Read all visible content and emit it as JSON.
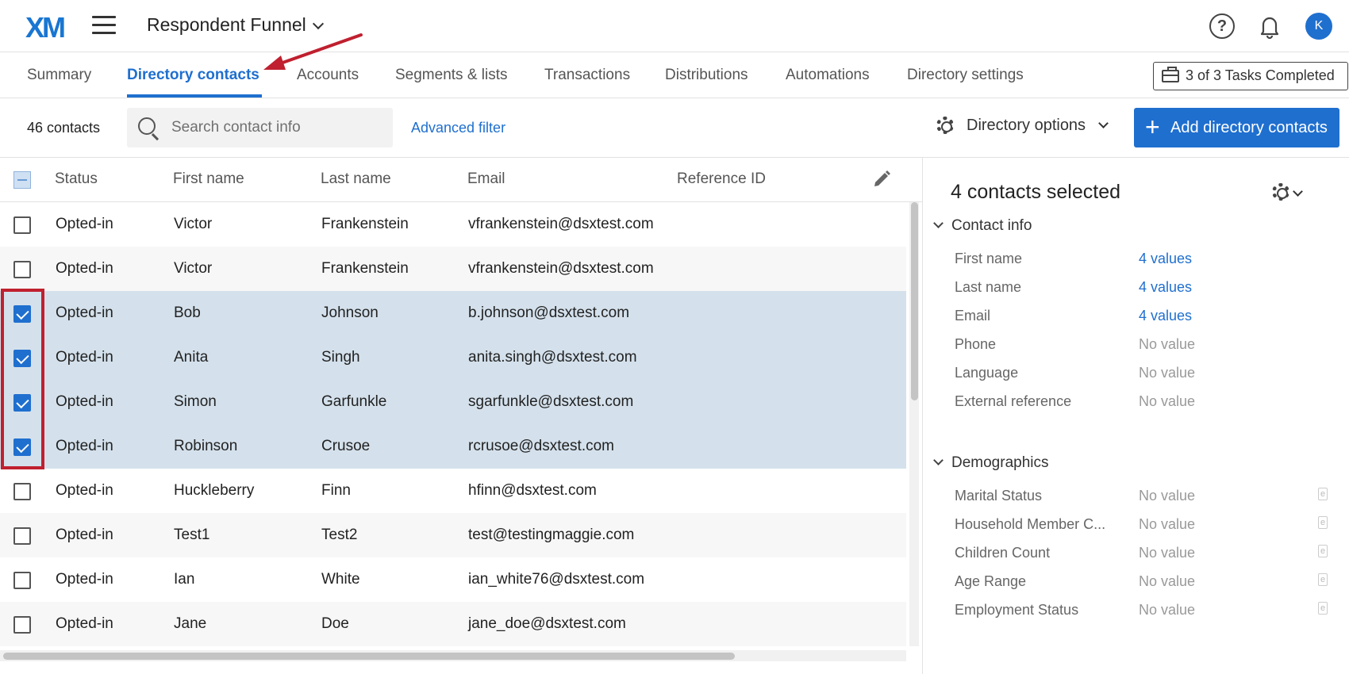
{
  "header": {
    "logo": "XM",
    "project": "Respondent Funnel",
    "help_glyph": "?",
    "avatar_initial": "K"
  },
  "tabs": [
    {
      "label": "Summary"
    },
    {
      "label": "Directory contacts"
    },
    {
      "label": "Accounts"
    },
    {
      "label": "Segments & lists"
    },
    {
      "label": "Transactions"
    },
    {
      "label": "Distributions"
    },
    {
      "label": "Automations"
    },
    {
      "label": "Directory settings"
    }
  ],
  "active_tab": "Directory contacts",
  "tasks_label": "3 of 3 Tasks Completed",
  "toolbar": {
    "count": "46 contacts",
    "search_placeholder": "Search contact info",
    "advanced_filter": "Advanced filter",
    "directory_options": "Directory options",
    "add_button": "Add directory contacts",
    "add_plus": "+"
  },
  "table": {
    "columns": [
      "Status",
      "First name",
      "Last name",
      "Email",
      "Reference ID"
    ],
    "rows": [
      {
        "status": "Opted-in",
        "first": "Victor",
        "last": "Frankenstein",
        "email": "vfrankenstein@dsxtest.com",
        "selected": false
      },
      {
        "status": "Opted-in",
        "first": "Victor",
        "last": "Frankenstein",
        "email": "vfrankenstein@dsxtest.com",
        "selected": false
      },
      {
        "status": "Opted-in",
        "first": "Bob",
        "last": "Johnson",
        "email": "b.johnson@dsxtest.com",
        "selected": true
      },
      {
        "status": "Opted-in",
        "first": "Anita",
        "last": "Singh",
        "email": "anita.singh@dsxtest.com",
        "selected": true
      },
      {
        "status": "Opted-in",
        "first": "Simon",
        "last": "Garfunkle",
        "email": "sgarfunkle@dsxtest.com",
        "selected": true
      },
      {
        "status": "Opted-in",
        "first": "Robinson",
        "last": "Crusoe",
        "email": "rcrusoe@dsxtest.com",
        "selected": true
      },
      {
        "status": "Opted-in",
        "first": "Huckleberry",
        "last": "Finn",
        "email": "hfinn@dsxtest.com",
        "selected": false
      },
      {
        "status": "Opted-in",
        "first": "Test1",
        "last": "Test2",
        "email": "test@testingmaggie.com",
        "selected": false
      },
      {
        "status": "Opted-in",
        "first": "Ian",
        "last": "White",
        "email": "ian_white76@dsxtest.com",
        "selected": false
      },
      {
        "status": "Opted-in",
        "first": "Jane",
        "last": "Doe",
        "email": "jane_doe@dsxtest.com",
        "selected": false
      }
    ]
  },
  "panel": {
    "title": "4 contacts selected",
    "contact_info": {
      "heading": "Contact info",
      "fields": [
        {
          "label": "First name",
          "value": "4 values",
          "link": true
        },
        {
          "label": "Last name",
          "value": "4 values",
          "link": true
        },
        {
          "label": "Email",
          "value": "4 values",
          "link": true
        },
        {
          "label": "Phone",
          "value": "No value",
          "link": false
        },
        {
          "label": "Language",
          "value": "No value",
          "link": false
        },
        {
          "label": "External reference",
          "value": "No value",
          "link": false
        }
      ]
    },
    "demographics": {
      "heading": "Demographics",
      "embedded_glyph": "e",
      "fields": [
        {
          "label": "Marital Status",
          "value": "No value"
        },
        {
          "label": "Household Member C...",
          "value": "No value"
        },
        {
          "label": "Children Count",
          "value": "No value"
        },
        {
          "label": "Age Range",
          "value": "No value"
        },
        {
          "label": "Employment Status",
          "value": "No value"
        }
      ]
    }
  },
  "colors": {
    "accent": "#1f6fcf",
    "selected_row": "#d4e1ec",
    "annotation": "#c0202f"
  },
  "icons": [
    "hamburger-icon",
    "chevron-down-icon",
    "help-icon",
    "bell-icon",
    "briefcase-icon",
    "search-icon",
    "gear-icon",
    "plus-icon",
    "pencil-icon",
    "checkbox-icon"
  ]
}
